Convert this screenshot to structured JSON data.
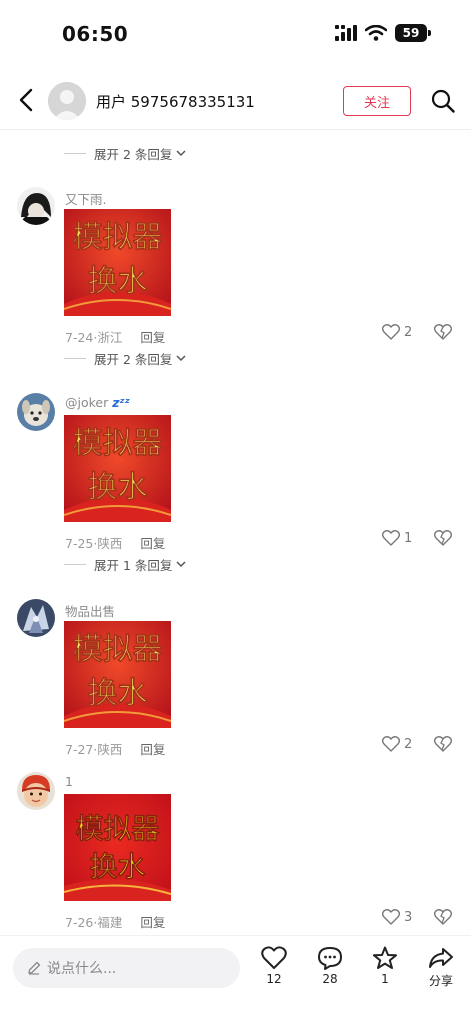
{
  "status_bar": {
    "time": "06:50",
    "battery": "59"
  },
  "header": {
    "title": "用户 5975678335131",
    "follow_label": "关注"
  },
  "poster_lines": [
    "模拟器",
    "换水"
  ],
  "expand_rows": [
    "展开 2 条回复",
    "展开 2 条回复",
    "展开 1 条回复"
  ],
  "comments": [
    {
      "name": "又下雨.",
      "date": "7-24",
      "location": "浙江",
      "reply_label": "回复",
      "likes": "2"
    },
    {
      "name": "@joker",
      "name_suffix": "zᶻᶻ",
      "date": "7-25",
      "location": "陕西",
      "reply_label": "回复",
      "likes": "1"
    },
    {
      "name": "物品出售",
      "date": "7-27",
      "location": "陕西",
      "reply_label": "回复",
      "likes": "2"
    },
    {
      "name": "1",
      "date": "7-26",
      "location": "福建",
      "reply_label": "回复",
      "likes": "3"
    }
  ],
  "bottom_bar": {
    "input_placeholder": "说点什么...",
    "like_count": "12",
    "comment_count": "28",
    "star_count": "1",
    "share_label": "分享"
  },
  "colors": {
    "accent": "#e23a55",
    "poster_red": "#c4161c",
    "poster_text": "#f3e04a"
  }
}
